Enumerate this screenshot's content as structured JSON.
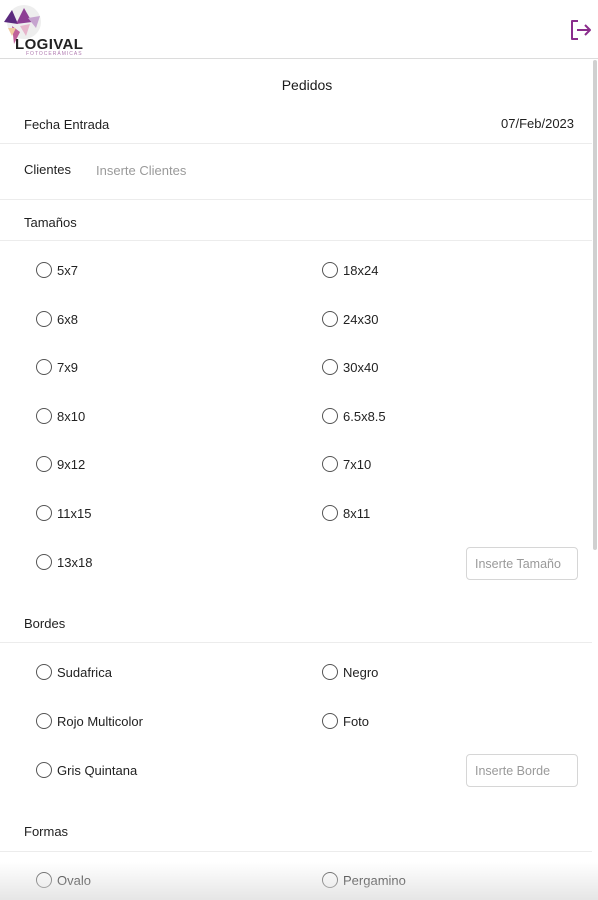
{
  "header": {
    "brand_name": "LOGIVAL",
    "brand_subtitle": "FOTOCERÁMICAS",
    "logout_icon": "logout-icon"
  },
  "page_title": "Pedidos",
  "fecha": {
    "label": "Fecha Entrada",
    "value": "07/Feb/2023"
  },
  "clientes": {
    "label": "Clientes",
    "placeholder": "Inserte Clientes",
    "value": ""
  },
  "tamanos": {
    "label": "Tamaños",
    "left": [
      "5x7",
      "6x8",
      "7x9",
      "8x10",
      "9x12",
      "11x15",
      "13x18"
    ],
    "right": [
      "18x24",
      "24x30",
      "30x40",
      "6.5x8.5",
      "7x10",
      "8x11"
    ],
    "other_placeholder": "Inserte Tamaño"
  },
  "bordes": {
    "label": "Bordes",
    "left": [
      "Sudafrica",
      "Rojo Multicolor",
      "Gris Quintana"
    ],
    "right": [
      "Negro",
      "Foto"
    ],
    "other_placeholder": "Inserte Borde"
  },
  "formas": {
    "label": "Formas",
    "left": [
      "Ovalo"
    ],
    "right": [
      "Pergamino"
    ]
  }
}
